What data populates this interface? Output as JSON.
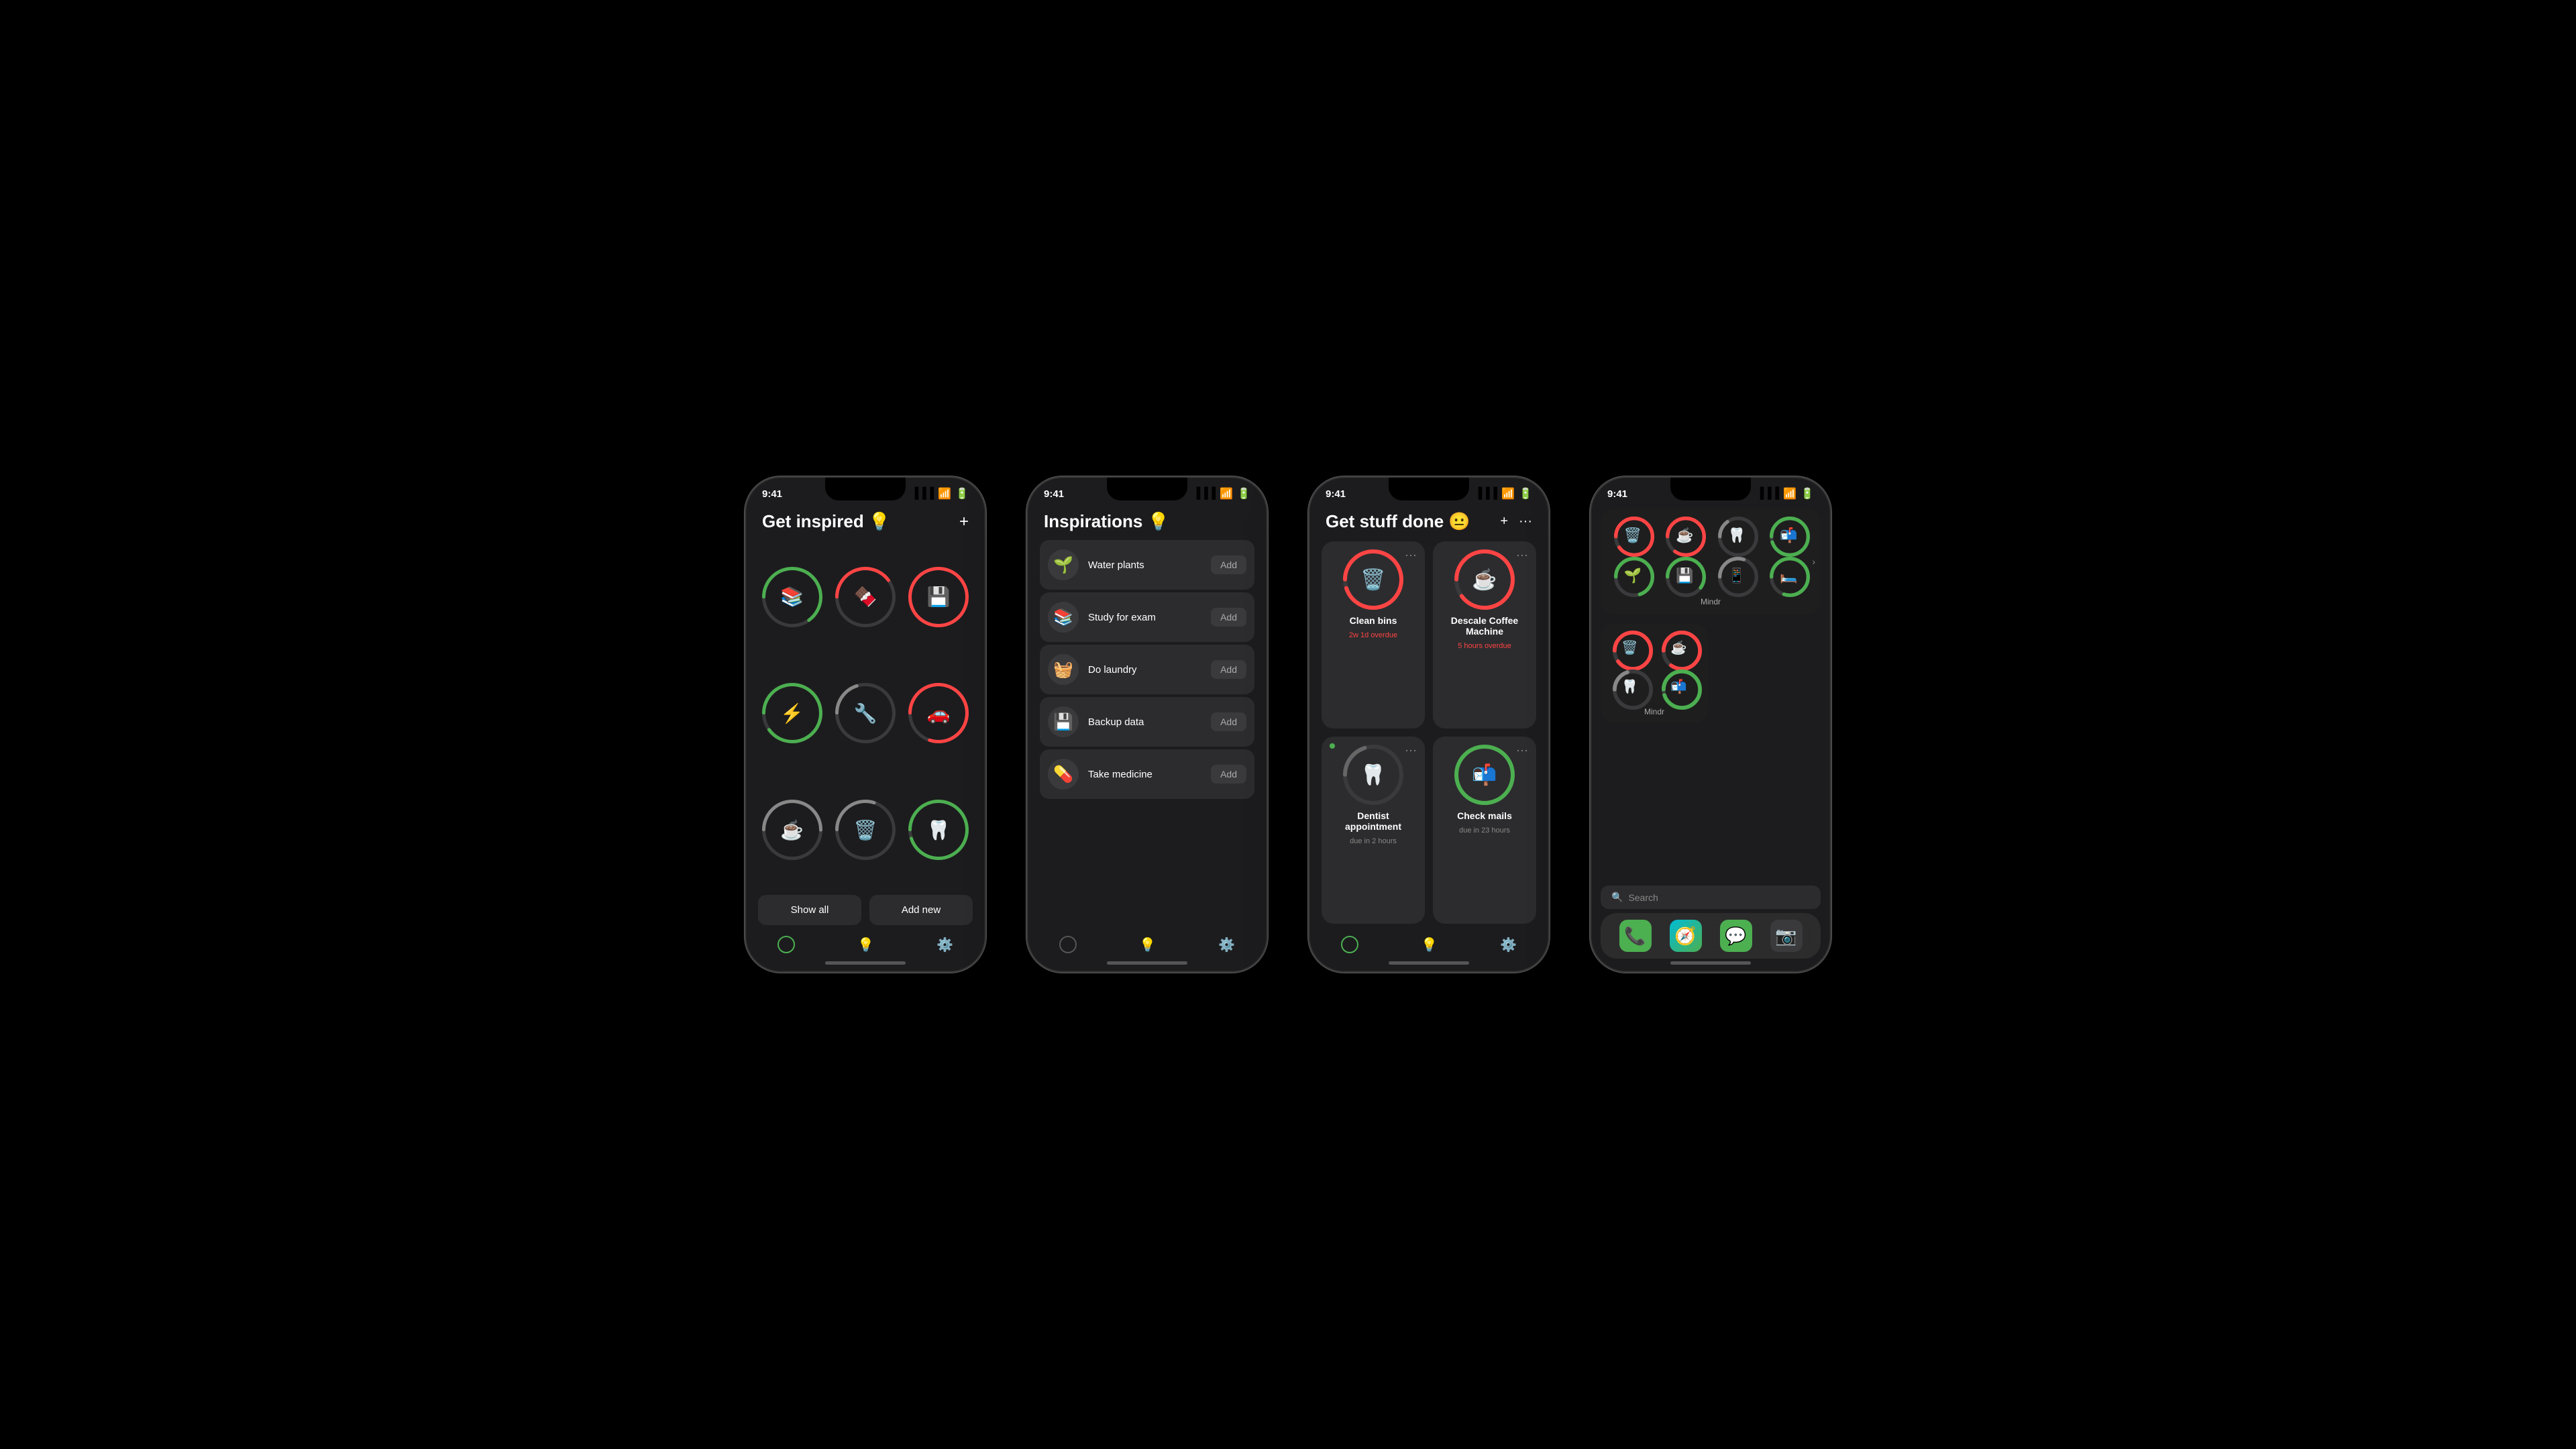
{
  "phones": [
    {
      "id": "phone1",
      "time": "9:41",
      "title": "Get inspired 💡",
      "plusBtn": "+",
      "habits": [
        {
          "emoji": "📚",
          "progress": 0.65,
          "color": "#4CAF50",
          "bg": "#333"
        },
        {
          "emoji": "🍫",
          "progress": 0.4,
          "color": "#f44",
          "bg": "#333"
        },
        {
          "emoji": "💾",
          "progress": 1.0,
          "color": "#f44",
          "bg": "#333"
        },
        {
          "emoji": "⚡",
          "progress": 0.9,
          "color": "#4CAF50",
          "bg": "#333"
        },
        {
          "emoji": "🔧",
          "progress": 0.2,
          "color": "#888",
          "bg": "#333"
        },
        {
          "emoji": "🚗",
          "progress": 0.8,
          "color": "#f44",
          "bg": "#333"
        },
        {
          "emoji": "☕",
          "progress": 0.5,
          "color": "#888",
          "bg": "#333"
        },
        {
          "emoji": "🗑️",
          "progress": 0.3,
          "color": "#888",
          "bg": "#333"
        },
        {
          "emoji": "🦷",
          "progress": 0.95,
          "color": "#4CAF50",
          "bg": "#333"
        }
      ],
      "showAllBtn": "Show all",
      "addNewBtn": "Add new",
      "nav": [
        "circle",
        "bulb",
        "gear"
      ]
    },
    {
      "id": "phone2",
      "time": "9:41",
      "title": "Inspirations 💡",
      "items": [
        {
          "icon": "🌱",
          "label": "Water plants",
          "addBtn": "Add"
        },
        {
          "icon": "📚",
          "label": "Study\nfor exam",
          "addBtn": "Add"
        },
        {
          "icon": "🧺",
          "label": "Do laundry",
          "addBtn": "Add"
        },
        {
          "icon": "💾",
          "label": "Backup data",
          "addBtn": "Add"
        },
        {
          "icon": "💊",
          "label": "Take medicine",
          "addBtn": "Add"
        }
      ],
      "nav": [
        "circle",
        "bulb",
        "gear"
      ]
    },
    {
      "id": "phone3",
      "time": "9:41",
      "title": "Get stuff done 😐",
      "plusBtn": "+",
      "dotsBtn": "···",
      "tasks": [
        {
          "emoji": "🗑️",
          "name": "Clean bins",
          "sub": "2w 1d overdue",
          "overdue": true,
          "progress": 0.95,
          "ringColor": "#f44"
        },
        {
          "emoji": "☕",
          "name": "Descale Coffee Machine",
          "sub": "5 hours overdue",
          "overdue": true,
          "progress": 0.9,
          "ringColor": "#f44"
        },
        {
          "emoji": "🦷",
          "name": "Dentist appointment",
          "sub": "due in 2 hours",
          "overdue": false,
          "progress": 0.2,
          "ringColor": "#666",
          "dotColor": "#4CAF50"
        },
        {
          "emoji": "📬",
          "name": "Check mails",
          "sub": "due in 23 hours",
          "overdue": false,
          "progress": 1.0,
          "ringColor": "#4CAF50"
        }
      ],
      "nav": [
        "circle",
        "bulb",
        "gear"
      ]
    },
    {
      "id": "phone4",
      "time": "9:41",
      "widgetLargeLabel": "Mindr",
      "widgetSmallLabel": "Mindr",
      "widgetItems1": [
        {
          "emoji": "🗑️",
          "progress": 0.9,
          "ringColor": "#f44"
        },
        {
          "emoji": "☕",
          "progress": 0.85,
          "ringColor": "#f44"
        },
        {
          "emoji": "🦷",
          "progress": 0.15,
          "ringColor": "#888"
        },
        {
          "emoji": "📬",
          "progress": 0.95,
          "ringColor": "#4CAF50"
        }
      ],
      "widgetExtraRow": [
        {
          "emoji": "🌱",
          "progress": 0.7,
          "ringColor": "#4CAF50"
        },
        {
          "emoji": "💾",
          "progress": 0.6,
          "ringColor": "#4CAF50"
        },
        {
          "emoji": "📱",
          "progress": 0.3,
          "ringColor": "#888"
        },
        {
          "emoji": "🛏️",
          "progress": 0.8,
          "ringColor": "#4CAF50"
        }
      ],
      "widgetItems2": [
        {
          "emoji": "🗑️",
          "progress": 0.9,
          "ringColor": "#f44"
        },
        {
          "emoji": "☕",
          "progress": 0.85,
          "ringColor": "#f44"
        },
        {
          "emoji": "🦷",
          "progress": 0.2,
          "ringColor": "#888"
        },
        {
          "emoji": "📬",
          "progress": 0.95,
          "ringColor": "#4CAF50"
        }
      ],
      "searchPlaceholder": "🔍 Search",
      "dockApps": [
        "📞",
        "🧭",
        "💬",
        "📷"
      ],
      "nav": []
    }
  ]
}
